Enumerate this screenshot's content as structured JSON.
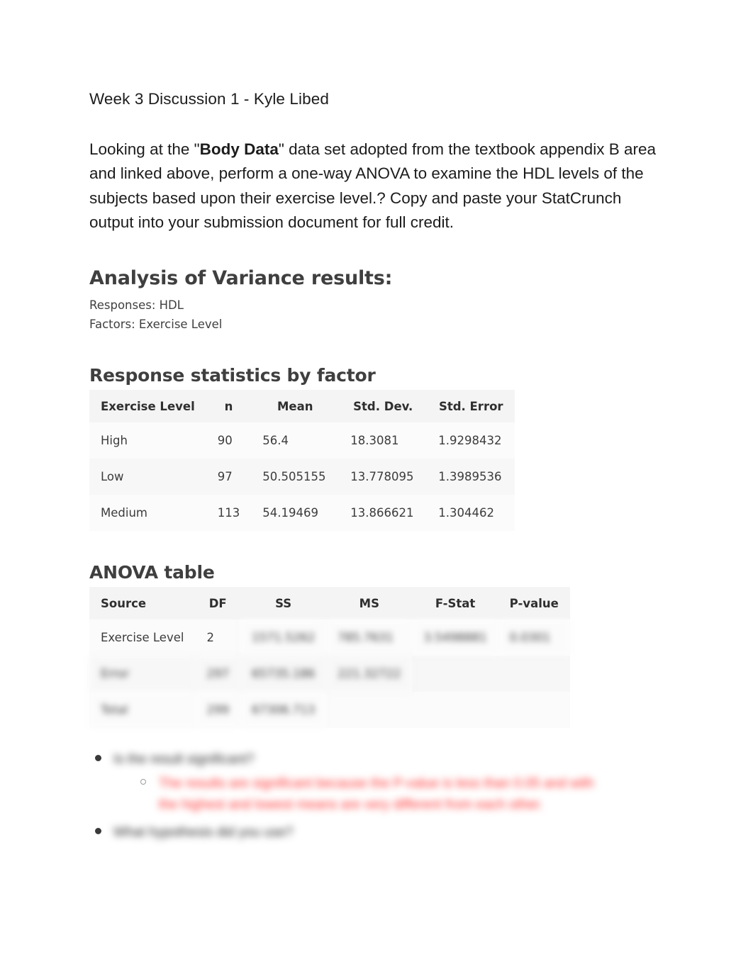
{
  "document": {
    "title": "Week 3 Discussion 1 - Kyle Libed",
    "intro_part1": "Looking at the \"",
    "intro_bold": "Body Data",
    "intro_part2": "\" data set adopted from the textbook appendix B area and linked above, perform a one-way ANOVA to examine the HDL levels of the subjects based upon their exercise level.? Copy and paste your StatCrunch output into your submission document for full credit."
  },
  "anova_results": {
    "heading": "Analysis of Variance results:",
    "responses_line": "Responses: HDL",
    "factors_line": "Factors: Exercise Level"
  },
  "response_stats": {
    "heading": "Response statistics by factor",
    "columns": [
      "Exercise Level",
      "n",
      "Mean",
      "Std. Dev.",
      "Std. Error"
    ],
    "rows": [
      {
        "level": "High",
        "n": "90",
        "mean": "56.4",
        "sd": "18.3081",
        "se": "1.9298432"
      },
      {
        "level": "Low",
        "n": "97",
        "mean": "50.505155",
        "sd": "13.778095",
        "se": "1.3989536"
      },
      {
        "level": "Medium",
        "n": "113",
        "mean": "54.19469",
        "sd": "13.866621",
        "se": "1.304462"
      }
    ]
  },
  "anova_table": {
    "heading": "ANOVA table",
    "columns": [
      "Source",
      "DF",
      "SS",
      "MS",
      "F-Stat",
      "P-value"
    ],
    "rows": [
      {
        "source": "Exercise Level",
        "source_blurred": false,
        "df": "2",
        "df_blurred": false,
        "ss": "1571.5262",
        "ss_blurred": true,
        "ms": "785.7631",
        "ms_blurred": true,
        "f": "3.5498881",
        "f_blurred": true,
        "p": "0.0301",
        "p_blurred": true
      },
      {
        "source": "Error",
        "source_blurred": true,
        "df": "297",
        "df_blurred": true,
        "ss": "65735.186",
        "ss_blurred": true,
        "ms": "221.32722",
        "ms_blurred": true,
        "f": "",
        "f_blurred": true,
        "p": "",
        "p_blurred": true
      },
      {
        "source": "Total",
        "source_blurred": true,
        "df": "299",
        "df_blurred": true,
        "ss": "67306.713",
        "ss_blurred": true,
        "ms": "",
        "ms_blurred": true,
        "f": "",
        "f_blurred": true,
        "p": "",
        "p_blurred": true
      }
    ]
  },
  "questions": [
    {
      "question": "Is the result significant?",
      "answer": "The results are significant because the P-value is less than 0.05 and with the highest and lowest means are very different from each other."
    },
    {
      "question": "What hypothesis did you use?",
      "answer": null
    }
  ],
  "colors": {
    "answer_red": "#ff2d2d",
    "heading_grey": "#3f3f3f",
    "body_black": "#1c1c1c",
    "table_header_bg": "#f4f4f4"
  }
}
